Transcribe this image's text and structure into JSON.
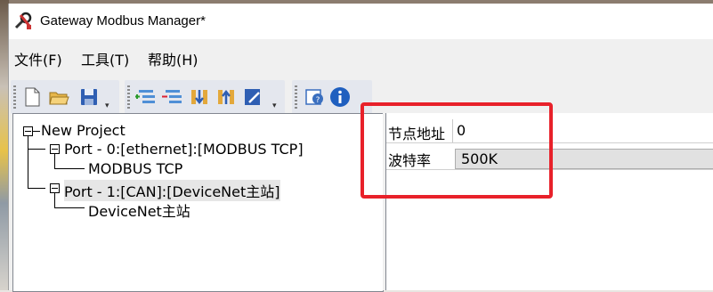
{
  "window": {
    "title": "Gateway Modbus Manager*"
  },
  "menu": [
    "文件(F)",
    "工具(T)",
    "帮助(H)"
  ],
  "toolbar1": {
    "icons": [
      "new-file-icon",
      "open-folder-icon",
      "save-icon"
    ]
  },
  "toolbar2": {
    "icons": [
      "add-port-icon",
      "remove-port-icon",
      "download-icon",
      "upload-icon",
      "edit-icon"
    ]
  },
  "toolbar3": {
    "icons": [
      "help-icon",
      "info-icon"
    ]
  },
  "tree": {
    "root": "New Project",
    "port0": "Port - 0:[ethernet]:[MODBUS TCP]",
    "port0_child": "MODBUS TCP",
    "port1": "Port - 1:[CAN]:[DeviceNet主站]",
    "port1_child": "DeviceNet主站"
  },
  "properties": {
    "rows": [
      {
        "label": "节点地址",
        "value": "0"
      },
      {
        "label": "波特率",
        "value": "500K"
      }
    ]
  },
  "colors": {
    "highlight_box": "#e8212a",
    "selection": "#e6e6e6"
  }
}
